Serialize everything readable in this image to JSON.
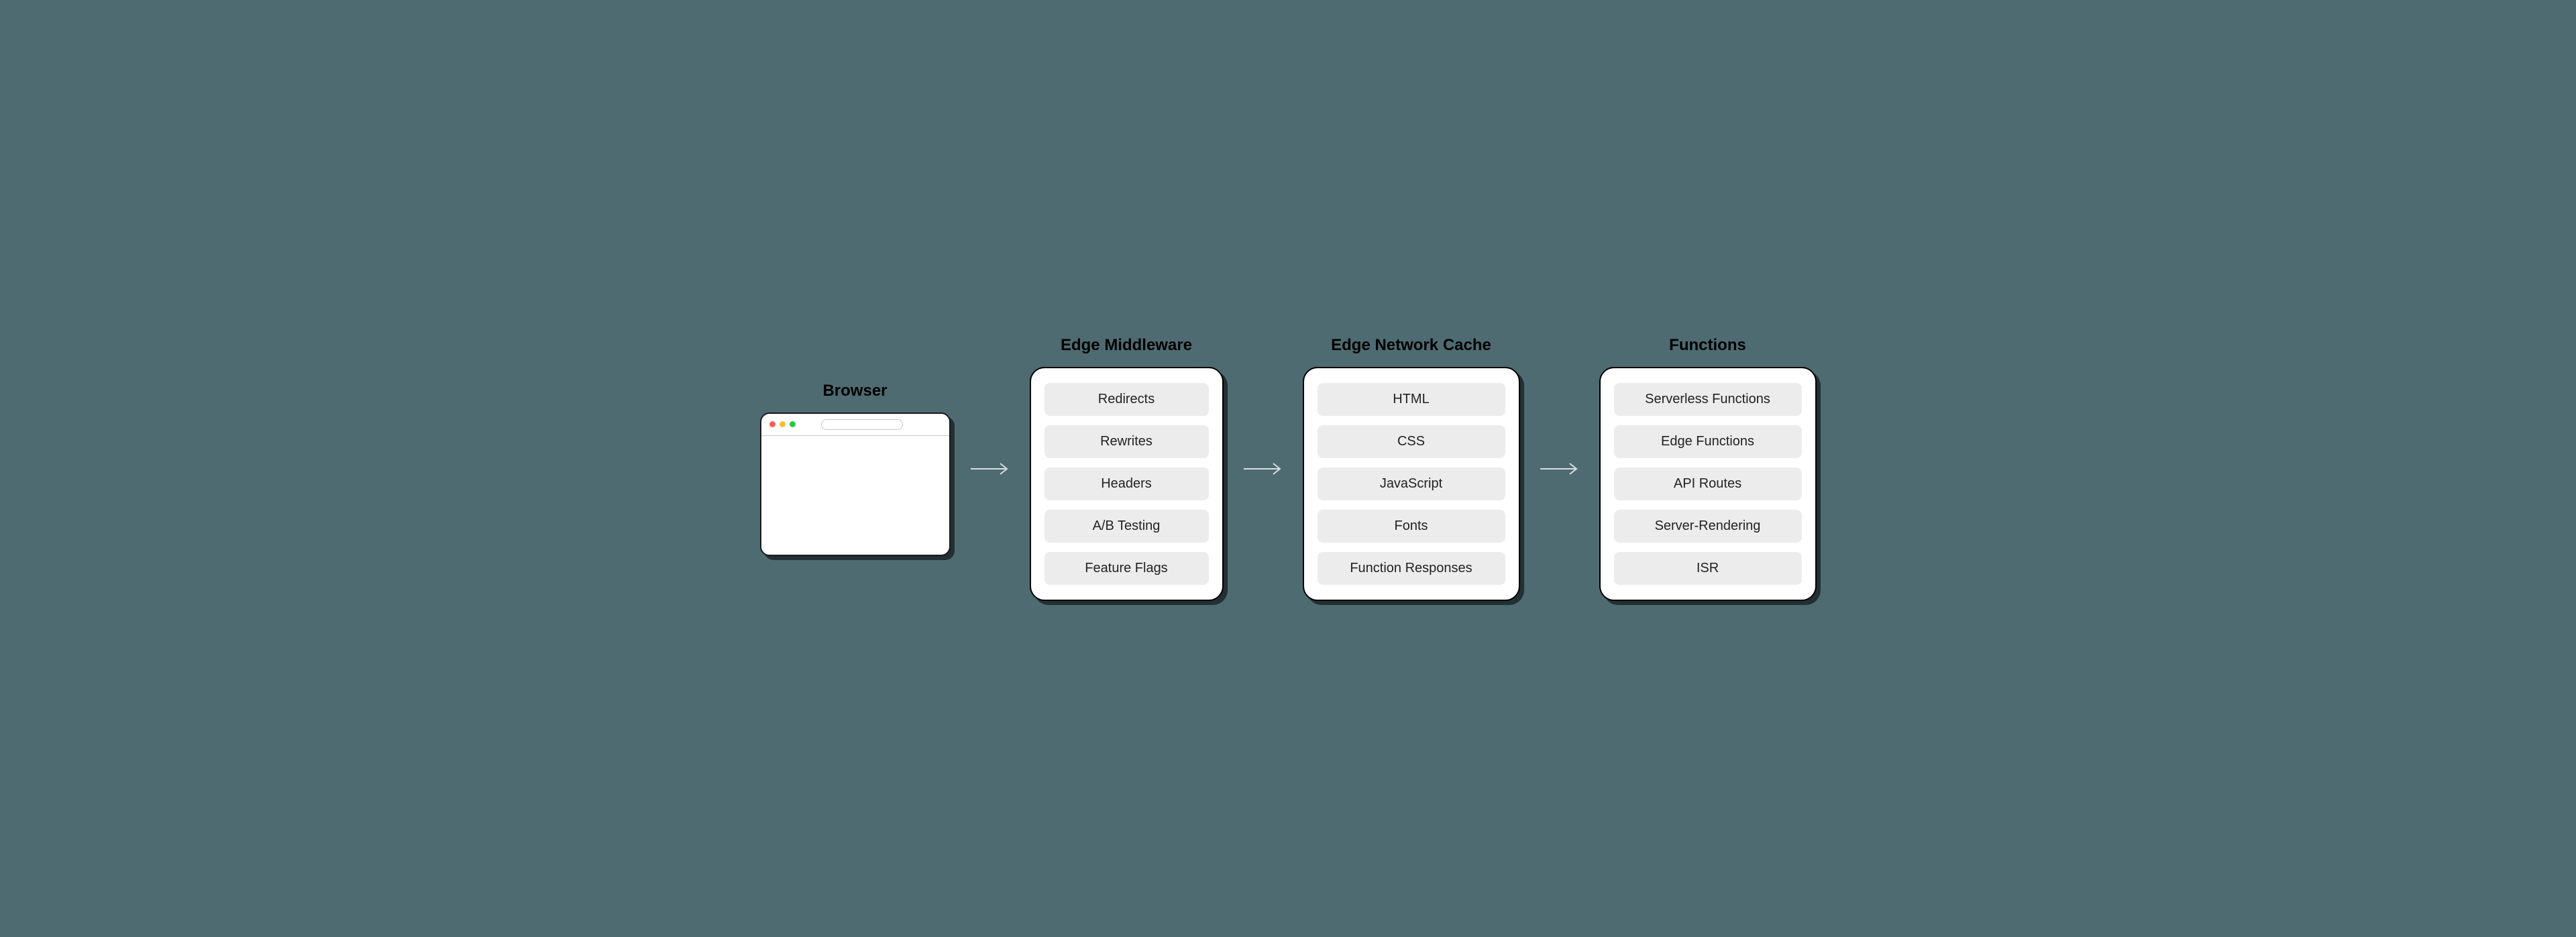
{
  "columns": {
    "browser": {
      "title": "Browser"
    },
    "middleware": {
      "title": "Edge Middleware",
      "items": [
        "Redirects",
        "Rewrites",
        "Headers",
        "A/B Testing",
        "Feature Flags"
      ]
    },
    "cache": {
      "title": "Edge Network Cache",
      "items": [
        "HTML",
        "CSS",
        "JavaScript",
        "Fonts",
        "Function Responses"
      ]
    },
    "functions": {
      "title": "Functions",
      "items": [
        "Serverless Functions",
        "Edge Functions",
        "API Routes",
        "Server-Rendering",
        "ISR"
      ]
    }
  }
}
